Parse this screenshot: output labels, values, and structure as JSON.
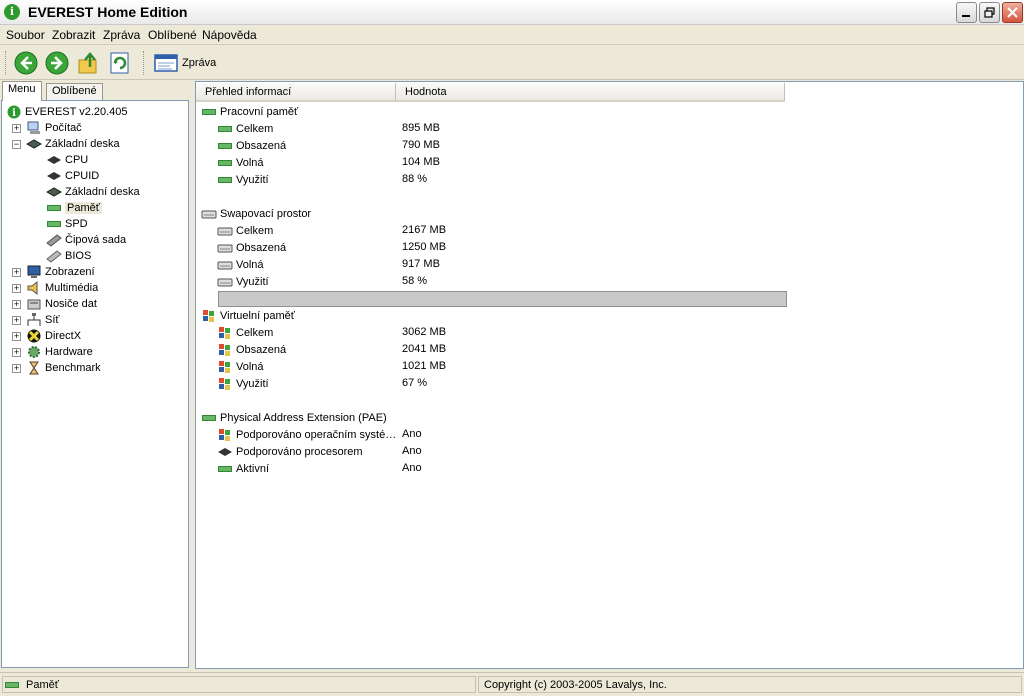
{
  "window": {
    "title": "EVEREST Home Edition",
    "icon": "i"
  },
  "menu": [
    "Soubor",
    "Zobrazit",
    "Zpráva",
    "Oblíbené",
    "Nápověda"
  ],
  "toolbar": {
    "report_label": "Zpráva"
  },
  "left_tabs": [
    "Menu",
    "Oblíbené"
  ],
  "tree": [
    {
      "label": "EVEREST v2.20.405",
      "icon": "info-icon"
    },
    {
      "label": "Počítač",
      "icon": "computer-icon"
    },
    {
      "label": "Základní deska",
      "icon": "motherboard-icon"
    },
    {
      "label": "CPU",
      "icon": "cpu-icon"
    },
    {
      "label": "CPUID",
      "icon": "cpu-icon"
    },
    {
      "label": "Základní deska",
      "icon": "motherboard-icon"
    },
    {
      "label": "Paměť",
      "icon": "memory-icon"
    },
    {
      "label": "SPD",
      "icon": "memory-icon"
    },
    {
      "label": "Čipová sada",
      "icon": "chipset-icon"
    },
    {
      "label": "BIOS",
      "icon": "bios-icon"
    },
    {
      "label": "Zobrazení",
      "icon": "monitor-icon"
    },
    {
      "label": "Multimédia",
      "icon": "speaker-icon"
    },
    {
      "label": "Nosiče dat",
      "icon": "storage-icon"
    },
    {
      "label": "Síť",
      "icon": "network-icon"
    },
    {
      "label": "DirectX",
      "icon": "directx-icon"
    },
    {
      "label": "Hardware",
      "icon": "hardware-icon"
    },
    {
      "label": "Benchmark",
      "icon": "hourglass-icon"
    }
  ],
  "columns": [
    "Přehled informací",
    "Hodnota"
  ],
  "sections": [
    {
      "title": "Pracovní paměť",
      "icon": "memory-icon",
      "rows": [
        {
          "label": "Celkem",
          "value": "895 MB"
        },
        {
          "label": "Obsazená",
          "value": "790 MB"
        },
        {
          "label": "Volná",
          "value": "104 MB"
        },
        {
          "label": "Využití",
          "value": "88 %"
        }
      ]
    },
    {
      "title": "Swapovací prostor",
      "icon": "drive-icon",
      "rows": [
        {
          "label": "Celkem",
          "value": "2167 MB"
        },
        {
          "label": "Obsazená",
          "value": "1250 MB"
        },
        {
          "label": "Volná",
          "value": "917 MB"
        },
        {
          "label": "Využití",
          "value": "58 %"
        }
      ]
    },
    {
      "title": "Virtuelní paměť",
      "icon": "windows-icon",
      "rows": [
        {
          "label": "Celkem",
          "value": "3062 MB"
        },
        {
          "label": "Obsazená",
          "value": "2041 MB"
        },
        {
          "label": "Volná",
          "value": "1021 MB"
        },
        {
          "label": "Využití",
          "value": "67 %"
        }
      ]
    },
    {
      "title": "Physical Address Extension (PAE)",
      "icon": "memory-icon",
      "rows": [
        {
          "label": "Podporováno operačním systé…",
          "value": "Ano",
          "icon": "windows-icon"
        },
        {
          "label": "Podporováno procesorem",
          "value": "Ano",
          "icon": "cpu-icon"
        },
        {
          "label": "Aktivní",
          "value": "Ano",
          "icon": "memory-icon"
        }
      ]
    }
  ],
  "swap_usage_fraction": 1.0,
  "status": {
    "left": "Paměť",
    "right": "Copyright (c) 2003-2005 Lavalys, Inc."
  }
}
